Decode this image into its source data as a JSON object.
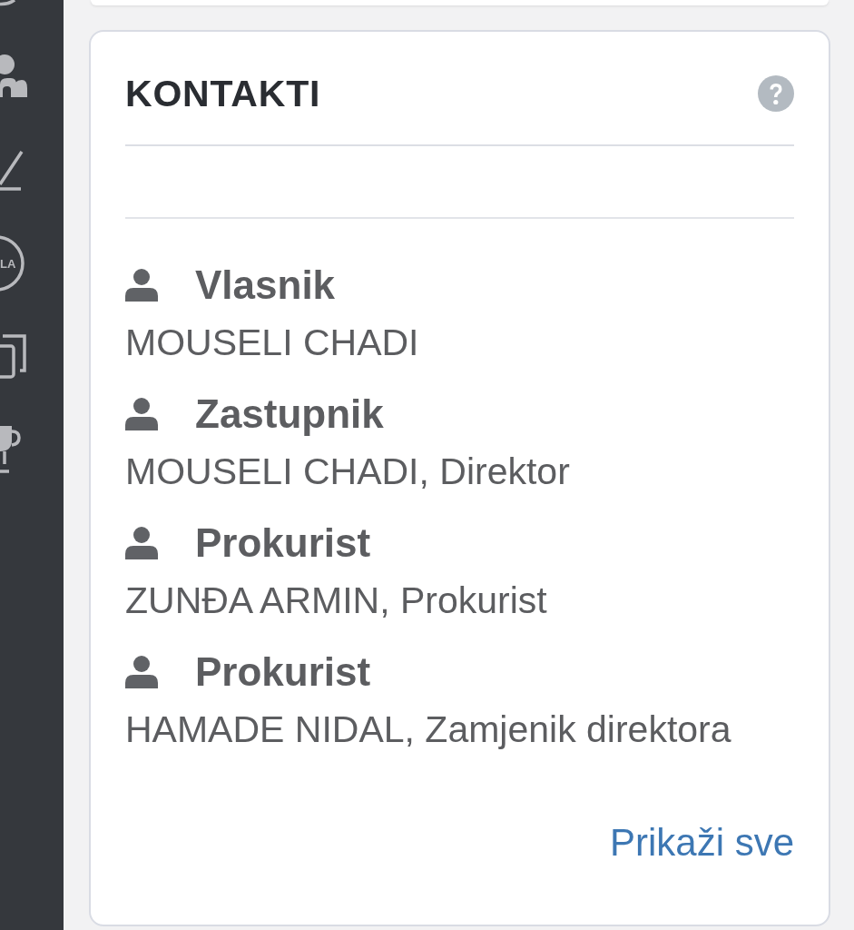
{
  "sidebar": {
    "items": [
      {
        "kind": "circle"
      },
      {
        "kind": "people"
      },
      {
        "kind": "angle"
      },
      {
        "kind": "badge",
        "label": "LA"
      },
      {
        "kind": "copy"
      },
      {
        "kind": "trophy"
      }
    ]
  },
  "card": {
    "title": "KONTAKTI",
    "contacts": [
      {
        "role": "Vlasnik",
        "name": "MOUSELI CHADI"
      },
      {
        "role": "Zastupnik",
        "name": "MOUSELI CHADI, Direktor"
      },
      {
        "role": "Prokurist",
        "name": "ZUNĐA ARMIN, Prokurist"
      },
      {
        "role": "Prokurist",
        "name": "HAMADE NIDAL, Zamjenik direktora"
      }
    ],
    "link": "Prikaži sve"
  }
}
